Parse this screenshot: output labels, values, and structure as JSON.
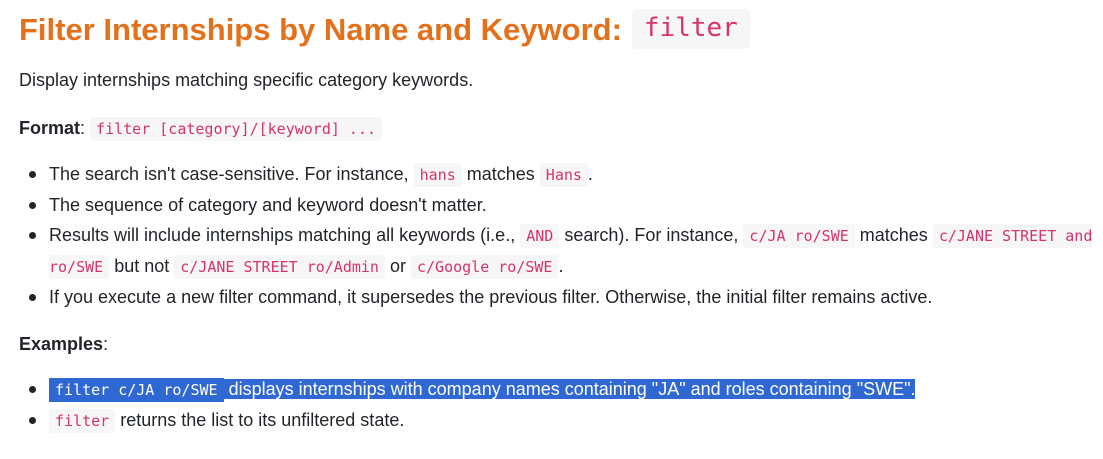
{
  "heading": {
    "title": "Filter Internships by Name and Keyword:",
    "command": "filter"
  },
  "description": "Display internships matching specific category keywords.",
  "format": {
    "label": "Format",
    "colon": ":",
    "code": "filter [category]/[keyword] ..."
  },
  "notes": {
    "item1": {
      "text_a": "The search isn't case-sensitive. For instance,",
      "code_a": "hans",
      "text_b": "matches",
      "code_b": "Hans",
      "text_c": "."
    },
    "item2": {
      "text": "The sequence of category and keyword doesn't matter."
    },
    "item3": {
      "text_a": "Results will include internships matching all keywords (i.e.,",
      "code_a": "AND",
      "text_b": "search). For instance,",
      "code_b": "c/JA ro/SWE",
      "text_c": "matches",
      "code_c": "c/JANE STREET and ro/SWE",
      "text_d": "but not",
      "code_d": "c/JANE STREET ro/Admin",
      "text_e": "or",
      "code_e": "c/Google ro/SWE",
      "text_f": "."
    },
    "item4": {
      "text": "If you execute a new filter command, it supersedes the previous filter. Otherwise, the initial filter remains active."
    }
  },
  "examples": {
    "label": "Examples",
    "colon": ":",
    "item1": {
      "code": "filter c/JA ro/SWE",
      "text": "displays internships with company names containing \"JA\" and roles containing \"SWE\"."
    },
    "item2": {
      "code": "filter",
      "text": "returns the list to its unfiltered state."
    }
  },
  "colors": {
    "heading": "#e3711c",
    "code_text": "#d6336c",
    "code_bg": "#f6f6f6",
    "selection": "#2f67d3"
  }
}
